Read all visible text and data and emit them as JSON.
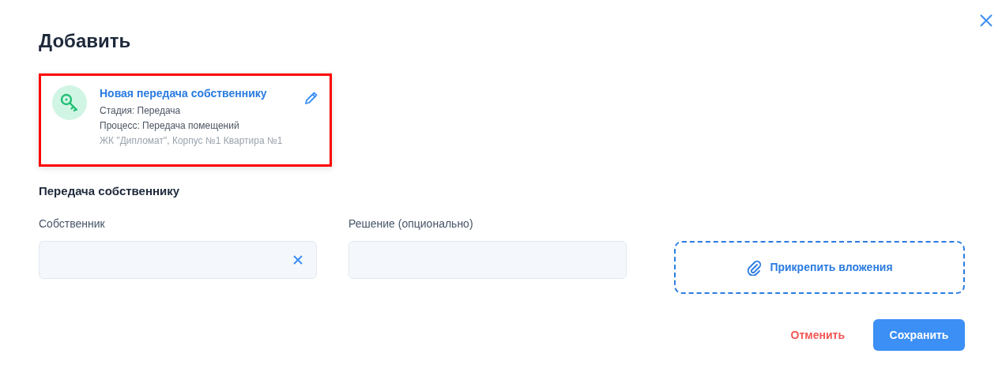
{
  "dialog": {
    "title": "Добавить"
  },
  "card": {
    "title": "Новая передача собственнику",
    "highlighted": true,
    "lines": [
      {
        "text": "Стадия: Передача",
        "kind": "detail"
      },
      {
        "text": "Процесс: Передача помещений",
        "kind": "detail"
      },
      {
        "text": "ЖК \"Дипломат\", Корпус №1 Квартира №1",
        "kind": "muted"
      }
    ]
  },
  "section": {
    "title": "Передача собственнику"
  },
  "fields": [
    {
      "label": "Собственник",
      "kind": "clearable"
    },
    {
      "label": "Решение (опционально)",
      "kind": "plain"
    }
  ],
  "attach": {
    "label": "Прикрепить вложения"
  },
  "buttons": [
    {
      "label": "Отменить",
      "kind": "cancel"
    },
    {
      "label": "Сохранить",
      "kind": "primary"
    }
  ]
}
